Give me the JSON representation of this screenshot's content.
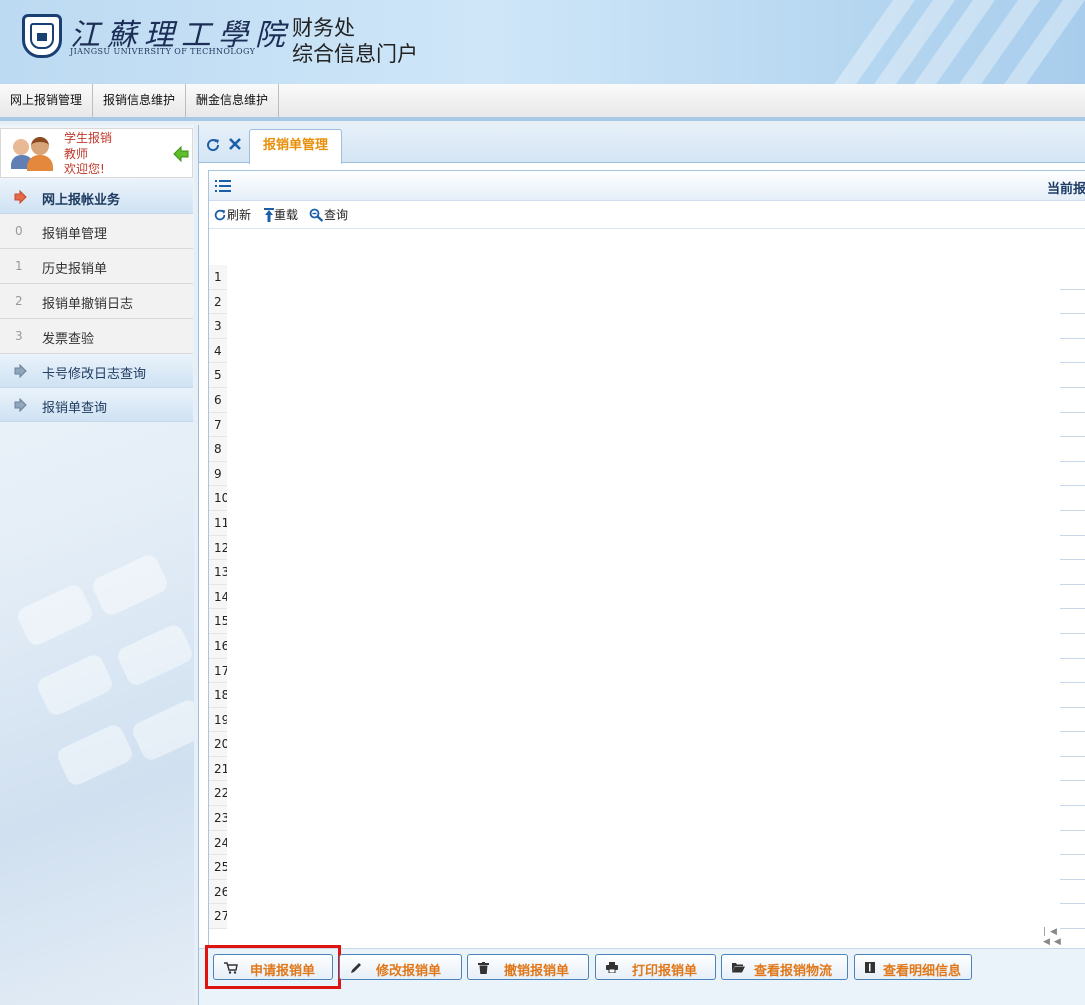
{
  "header": {
    "university_cn": "江蘇理工學院",
    "university_en": "JIANGSU UNIVERSITY OF TECHNOLOGY",
    "portal_line1": "财务处",
    "portal_line2": "综合信息门户"
  },
  "topmenu": [
    "网上报销管理",
    "报销信息维护",
    "酬金信息维护"
  ],
  "user": {
    "role": "学生报销",
    "title": "教师",
    "welcome": "欢迎您!"
  },
  "sidebar": {
    "groups": [
      {
        "label": "网上报帐业务",
        "icon": "arrow-right-icon",
        "active": true
      },
      {
        "label": "卡号修改日志查询",
        "icon": "arrow-right-icon"
      },
      {
        "label": "报销单查询",
        "icon": "arrow-right-icon"
      }
    ],
    "items": [
      {
        "num": "0",
        "label": "报销单管理"
      },
      {
        "num": "1",
        "label": "历史报销单"
      },
      {
        "num": "2",
        "label": "报销单撤销日志"
      },
      {
        "num": "3",
        "label": "发票查验"
      }
    ]
  },
  "tab": {
    "label": "报销单管理"
  },
  "panel": {
    "title": "当前报",
    "toolbar": {
      "refresh": "刷新",
      "reload": "重载",
      "query": "查询"
    },
    "row_numbers": [
      "1",
      "2",
      "3",
      "4",
      "5",
      "6",
      "7",
      "8",
      "9",
      "10",
      "11",
      "12",
      "13",
      "14",
      "15",
      "16",
      "17",
      "18",
      "19",
      "20",
      "21",
      "22",
      "23",
      "24",
      "25",
      "26",
      "27"
    ],
    "pager": "|◀ ◀◀"
  },
  "actions": [
    {
      "label": "申请报销单",
      "icon": "cart-icon"
    },
    {
      "label": "修改报销单",
      "icon": "pencil-icon"
    },
    {
      "label": "撤销报销单",
      "icon": "trash-icon"
    },
    {
      "label": "打印报销单",
      "icon": "print-icon"
    },
    {
      "label": "查看报销物流",
      "icon": "folder-icon"
    },
    {
      "label": "查看明细信息",
      "icon": "book-icon"
    }
  ],
  "colors": {
    "accent_orange": "#e0781a",
    "highlight_red": "#e0140f",
    "nav_blue": "#1c3c66"
  }
}
